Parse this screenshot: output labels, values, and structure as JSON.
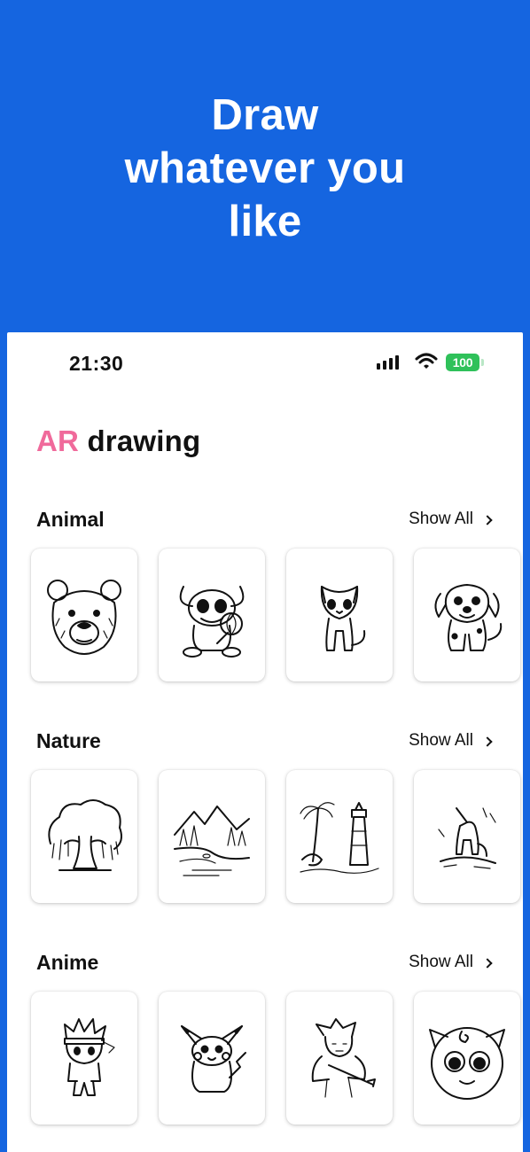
{
  "promo": {
    "headline_lines": [
      "Draw",
      "whatever you",
      "like"
    ]
  },
  "colors": {
    "background": "#1565e0",
    "brand_accent": "#f06a9b",
    "battery": "#2fc15a"
  },
  "status_bar": {
    "time": "21:30",
    "battery": "100"
  },
  "app": {
    "brand_accent": "AR",
    "brand_rest": " drawing"
  },
  "sections": [
    {
      "title": "Animal",
      "show_all": "Show All",
      "items": [
        "bear-drawing",
        "alien-with-lollipop-drawing",
        "cat-drawing",
        "puppy-drawing"
      ]
    },
    {
      "title": "Nature",
      "show_all": "Show All",
      "items": [
        "willow-tree-drawing",
        "mountain-river-drawing",
        "lighthouse-drawing",
        "howling-wolf-drawing"
      ]
    },
    {
      "title": "Anime",
      "show_all": "Show All",
      "items": [
        "ninja-boy-drawing",
        "pikachu-drawing",
        "swordsman-drawing",
        "round-pink-creature-drawing"
      ]
    }
  ]
}
